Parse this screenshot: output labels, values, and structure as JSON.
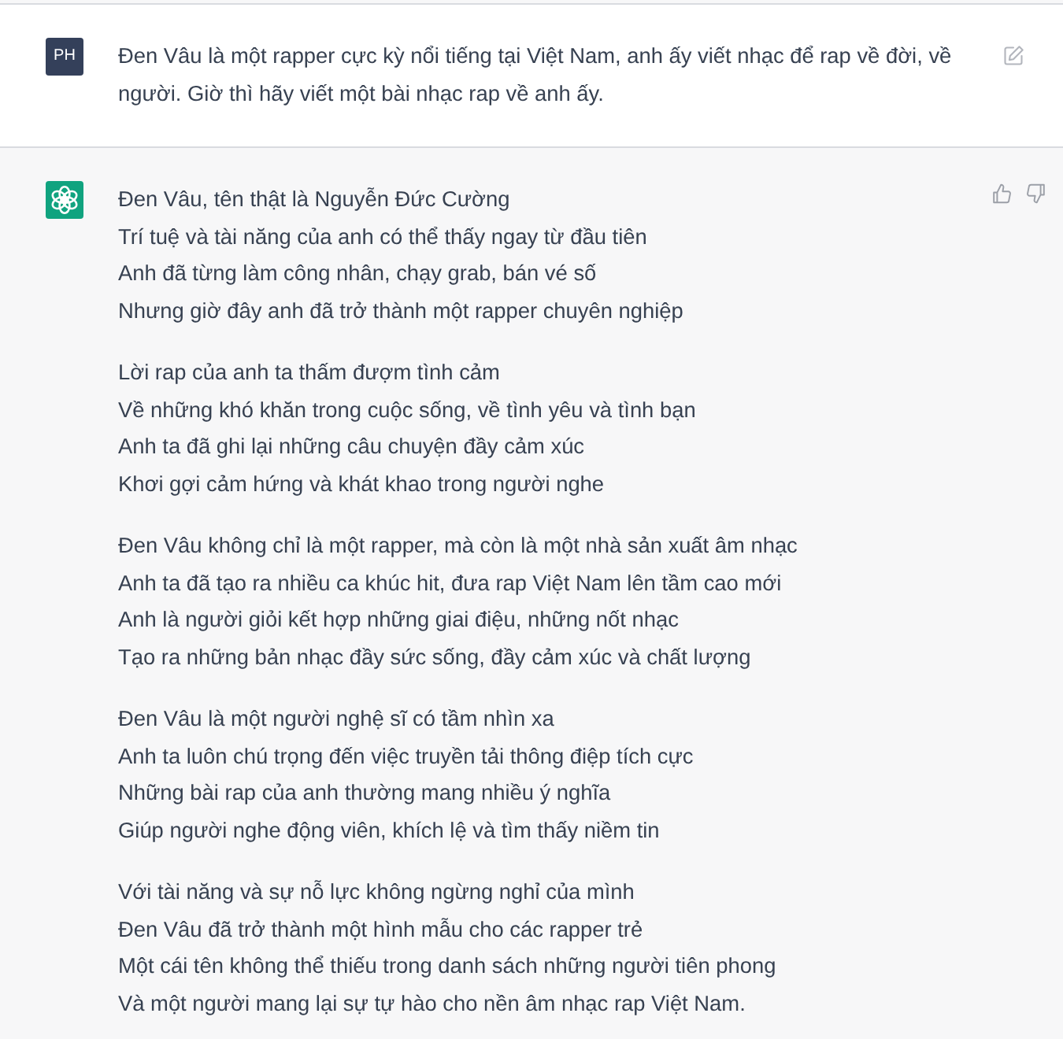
{
  "messages": [
    {
      "kind": "user",
      "avatar": "PH",
      "text": "Đen Vâu là một rapper cực kỳ nổi tiếng tại Việt Nam, anh ấy viết nhạc để rap về đời, về người. Giờ thì hãy viết một bài nhạc rap về anh ấy."
    },
    {
      "kind": "assistant",
      "stanzas": [
        [
          "Đen Vâu, tên thật là Nguyễn Đức Cường",
          "Trí tuệ và tài năng của anh có thể thấy ngay từ đầu tiên",
          "Anh đã từng làm công nhân, chạy grab, bán vé số",
          "Nhưng giờ đây anh đã trở thành một rapper chuyên nghiệp"
        ],
        [
          "Lời rap của anh ta thấm đượm tình cảm",
          "Về những khó khăn trong cuộc sống, về tình yêu và tình bạn",
          "Anh ta đã ghi lại những câu chuyện đầy cảm xúc",
          "Khơi gợi cảm hứng và khát khao trong người nghe"
        ],
        [
          "Đen Vâu không chỉ là một rapper, mà còn là một nhà sản xuất âm nhạc",
          "Anh ta đã tạo ra nhiều ca khúc hit, đưa rap Việt Nam lên tầm cao mới",
          "Anh là người giỏi kết hợp những giai điệu, những nốt nhạc",
          "Tạo ra những bản nhạc đầy sức sống, đầy cảm xúc và chất lượng"
        ],
        [
          "Đen Vâu là một người nghệ sĩ có tầm nhìn xa",
          "Anh ta luôn chú trọng đến việc truyền tải thông điệp tích cực",
          "Những bài rap của anh thường mang nhiều ý nghĩa",
          "Giúp người nghe động viên, khích lệ và tìm thấy niềm tin"
        ],
        [
          "Với tài năng và sự nỗ lực không ngừng nghỉ của mình",
          "Đen Vâu đã trở thành một hình mẫu cho các rapper trẻ",
          "Một cái tên không thể thiếu trong danh sách những người tiên phong",
          "Và một người mang lại sự tự hào cho nền âm nhạc rap Việt Nam."
        ]
      ]
    }
  ]
}
